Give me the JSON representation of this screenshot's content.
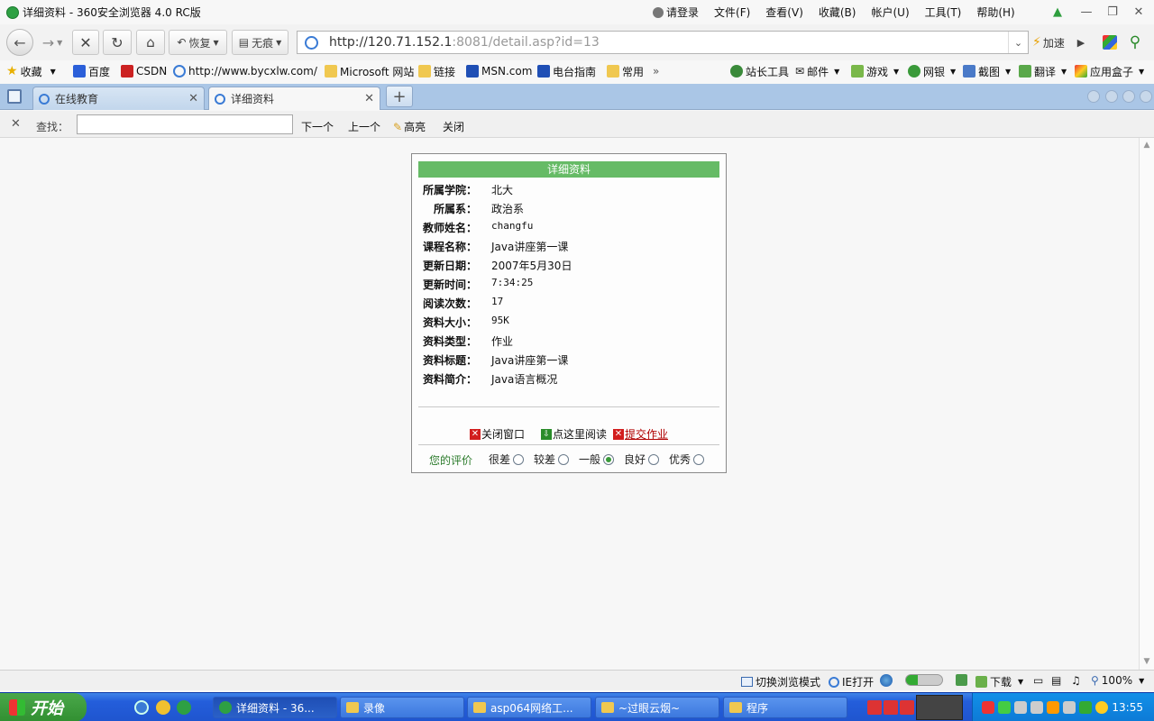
{
  "window": {
    "title": "详细资料 - 360安全浏览器 4.0 RC版",
    "menu": {
      "login": "请登录",
      "items": [
        "文件(F)",
        "查看(V)",
        "收藏(B)",
        "帐户(U)",
        "工具(T)",
        "帮助(H)"
      ]
    }
  },
  "toolbar": {
    "restore_label": "恢复",
    "notrace_label": "无痕",
    "address_host": "http://120.71.152.1",
    "address_rest": ":8081/detail.asp?id=13",
    "speedup_label": "加速"
  },
  "favorites": {
    "items": [
      "收藏",
      "百度",
      "CSDN",
      "http://www.bycxlw.com/",
      "Microsoft 网站",
      "链接",
      "MSN.com",
      "电台指南",
      "常用"
    ],
    "more": "»",
    "right_items": [
      "站长工具",
      "邮件",
      "游戏",
      "网银",
      "截图",
      "翻译",
      "应用盒子"
    ]
  },
  "tabs": [
    {
      "label": "在线教育",
      "active": false
    },
    {
      "label": "详细资料",
      "active": true
    }
  ],
  "findbar": {
    "label": "查找：",
    "input_value": "",
    "next": "下一个",
    "prev": "上一个",
    "highlight": "高亮",
    "close": "关闭"
  },
  "detail": {
    "header": "详细资料",
    "fields": [
      {
        "key": "所属学院：",
        "value": "北大"
      },
      {
        "key": "所属系：",
        "value": "政治系"
      },
      {
        "key": "教师姓名：",
        "value": "changfu"
      },
      {
        "key": "课程名称：",
        "value": "Java讲座第一课"
      },
      {
        "key": "更新日期：",
        "value": "2007年5月30日"
      },
      {
        "key": "更新时间：",
        "value": "7:34:25"
      },
      {
        "key": "阅读次数：",
        "value": "17"
      },
      {
        "key": "资料大小：",
        "value": "95K"
      },
      {
        "key": "资料类型：",
        "value": "作业"
      },
      {
        "key": "资料标题：",
        "value": "Java讲座第一课"
      },
      {
        "key": "资料简介：",
        "value": "Java语言概况"
      }
    ],
    "actions": {
      "close_window": "关闭窗口",
      "read_here": "点这里阅读",
      "submit_homework": "提交作业"
    },
    "rating": {
      "label": "您的评价",
      "options": [
        "很差",
        "较差",
        "一般",
        "良好",
        "优秀"
      ],
      "selected": "一般"
    }
  },
  "statusbar": {
    "switch_mode": "切换浏览模式",
    "ie_open": "IE打开",
    "download": "下载",
    "zoom": "100%"
  },
  "taskbar": {
    "start": "开始",
    "tasks": [
      "详细资料 - 36...",
      "录像",
      "asp064网络工...",
      "~过眼云烟~",
      "程序"
    ],
    "clock": "13:55"
  }
}
